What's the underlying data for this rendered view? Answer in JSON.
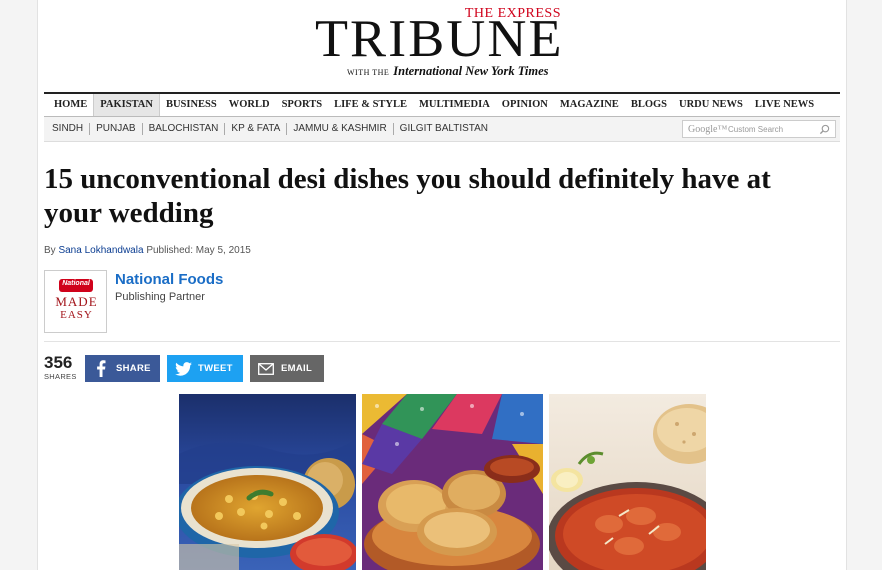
{
  "masthead": {
    "express": "THE EXPRESS",
    "tribune": "TRIBUNE",
    "with_the": "WITH THE",
    "partner_paper": "International New York Times"
  },
  "nav": {
    "items": [
      "HOME",
      "PAKISTAN",
      "BUSINESS",
      "WORLD",
      "SPORTS",
      "LIFE & STYLE",
      "MULTIMEDIA",
      "OPINION",
      "MAGAZINE",
      "BLOGS",
      "URDU NEWS",
      "LIVE NEWS"
    ],
    "active": "PAKISTAN"
  },
  "subnav": {
    "items": [
      "SINDH",
      "PUNJAB",
      "BALOCHISTAN",
      "KP & FATA",
      "JAMMU & KASHMIR",
      "GILGIT BALTISTAN"
    ]
  },
  "search": {
    "google": "Google™",
    "placeholder": "Custom Search"
  },
  "article": {
    "headline": "15 unconventional desi dishes you should definitely have at your wedding",
    "by": "By",
    "author": "Sana Lokhandwala",
    "published": "Published: May 5, 2015"
  },
  "partner": {
    "name": "National Foods",
    "role": "Publishing Partner",
    "logo_badge": "National",
    "logo_line1": "MADE",
    "logo_line2": "EASY"
  },
  "share": {
    "count": "356",
    "count_label": "SHARES",
    "facebook_label": "SHARE",
    "twitter_label": "TWEET",
    "email_label": "EMAIL"
  },
  "colors": {
    "brand_red": "#d0021b",
    "link_blue": "#1a6dc6",
    "facebook": "#3b5998",
    "twitter": "#1da1f2",
    "email": "#666666"
  },
  "icons": [
    "search-icon",
    "facebook-icon",
    "twitter-icon",
    "email-icon"
  ]
}
